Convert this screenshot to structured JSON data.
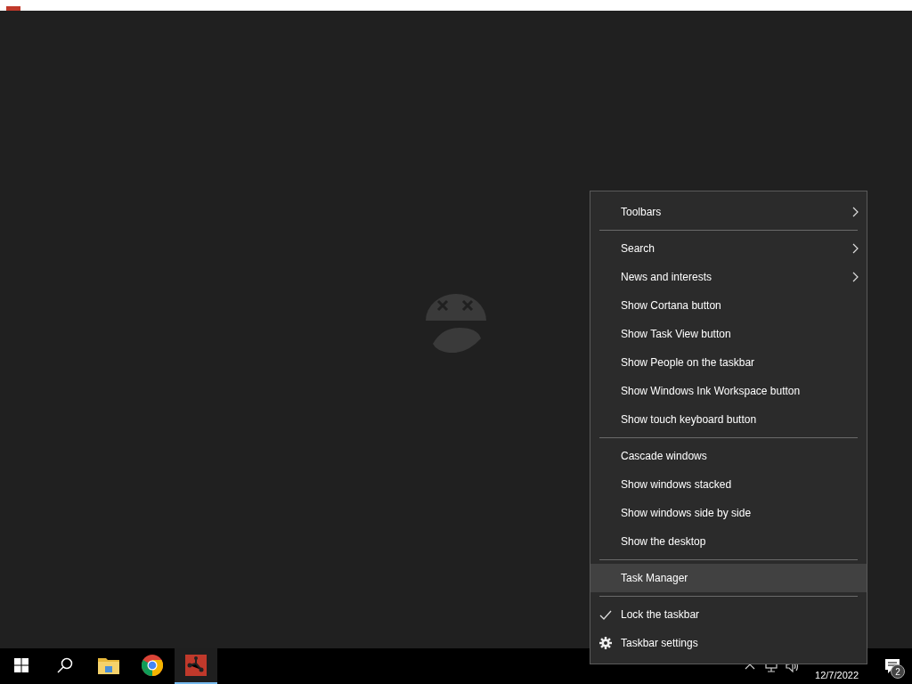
{
  "context_menu": {
    "groups": [
      [
        {
          "label": "Toolbars",
          "kind": "submenu",
          "selected": false
        }
      ],
      [
        {
          "label": "Search",
          "kind": "submenu",
          "selected": false
        },
        {
          "label": "News and interests",
          "kind": "submenu",
          "selected": false
        },
        {
          "label": "Show Cortana button",
          "kind": "plain",
          "selected": false
        },
        {
          "label": "Show Task View button",
          "kind": "plain",
          "selected": false
        },
        {
          "label": "Show People on the taskbar",
          "kind": "plain",
          "selected": false
        },
        {
          "label": "Show Windows Ink Workspace button",
          "kind": "plain",
          "selected": false
        },
        {
          "label": "Show touch keyboard button",
          "kind": "plain",
          "selected": false
        }
      ],
      [
        {
          "label": "Cascade windows",
          "kind": "plain",
          "selected": false
        },
        {
          "label": "Show windows stacked",
          "kind": "plain",
          "selected": false
        },
        {
          "label": "Show windows side by side",
          "kind": "plain",
          "selected": false
        },
        {
          "label": "Show the desktop",
          "kind": "plain",
          "selected": false
        }
      ],
      [
        {
          "label": "Task Manager",
          "kind": "plain",
          "selected": true
        }
      ],
      [
        {
          "label": "Lock the taskbar",
          "kind": "check",
          "checked": true,
          "selected": false
        },
        {
          "label": "Taskbar settings",
          "kind": "settings",
          "selected": false
        }
      ]
    ]
  },
  "taskbar": {
    "apps": [
      {
        "kind": "start",
        "selected": false
      },
      {
        "kind": "search",
        "selected": false
      },
      {
        "kind": "folder",
        "selected": false
      },
      {
        "kind": "browser",
        "selected": false
      },
      {
        "kind": "app",
        "selected": true
      }
    ],
    "date": "12/7/2022",
    "notification_count": "2"
  }
}
